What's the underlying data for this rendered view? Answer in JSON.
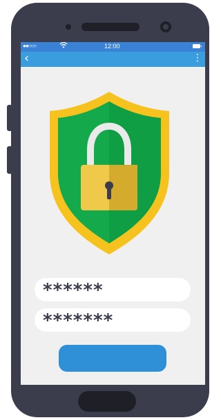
{
  "status_bar": {
    "signal": "●●○○○",
    "wifi_icon": "wifi-icon",
    "time": "12:00",
    "battery_icon": "battery-icon"
  },
  "app_bar": {
    "back_icon": "‹",
    "menu_icon": "⋮"
  },
  "login": {
    "username_value": "******",
    "password_value": "*******",
    "submit_label": ""
  },
  "colors": {
    "status_bar": "#3a82d6",
    "app_bar": "#3a9ddd",
    "shield_outer": "#f6c31e",
    "shield_green": "#14a94b",
    "lock_body": "#f1c94a",
    "button": "#2f8fd7",
    "phone_body": "#3b3d4c"
  }
}
